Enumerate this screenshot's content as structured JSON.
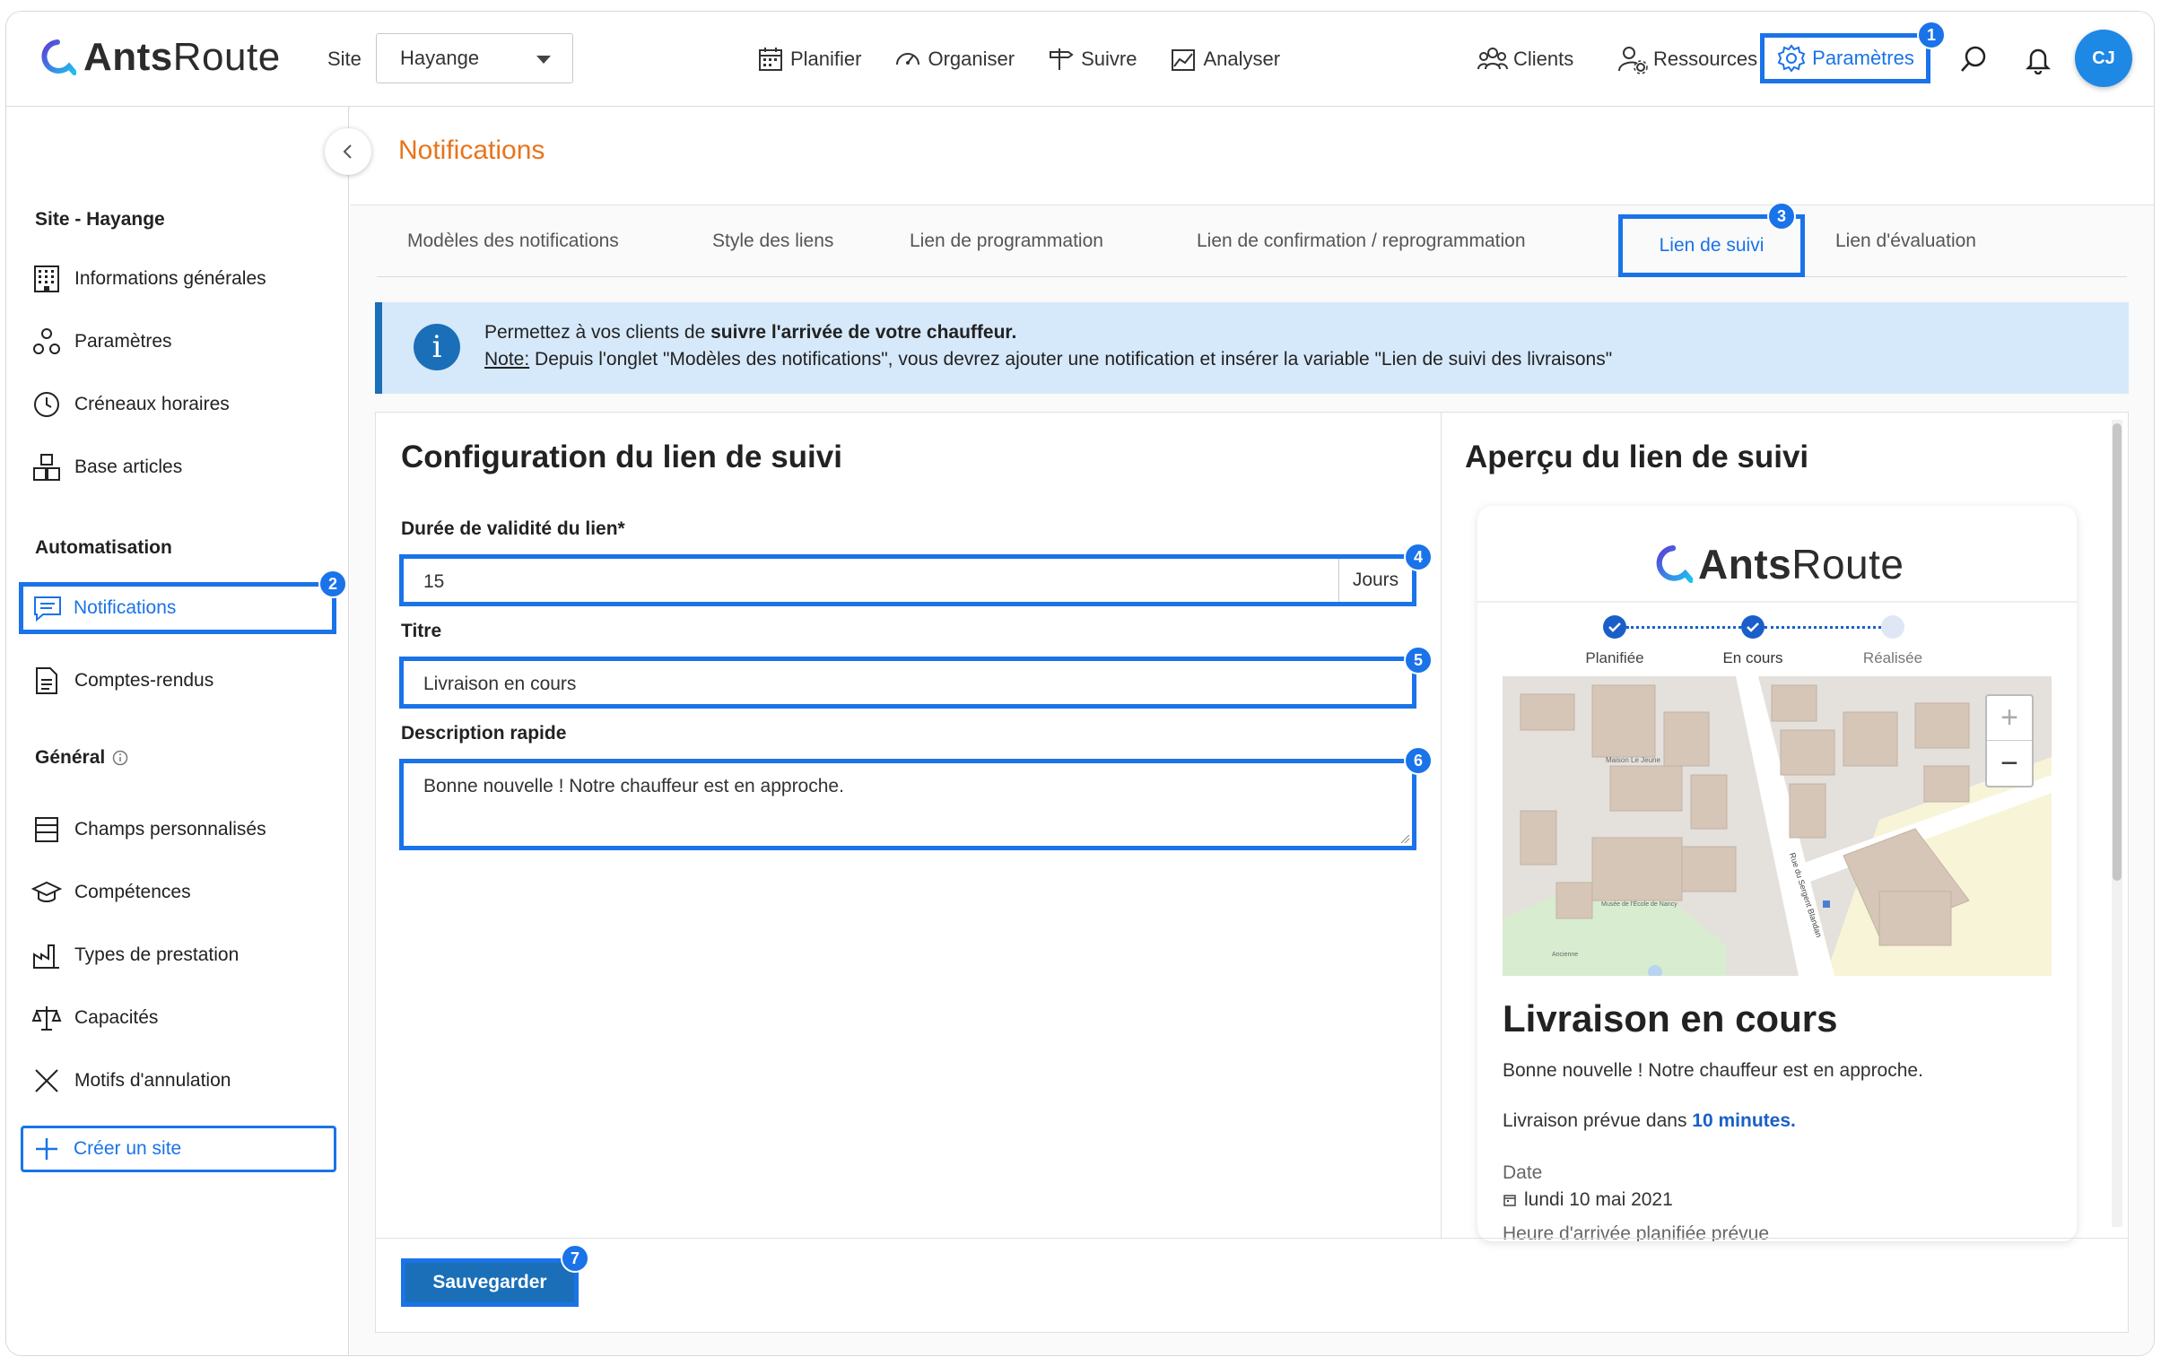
{
  "app": {
    "logo_text_bold": "Ants",
    "logo_text_rest": "Route",
    "site_label": "Site",
    "site_value": "Hayange",
    "user_initials": "CJ",
    "accent_color": "#1a73e8",
    "title_color": "#e8741b"
  },
  "nav": {
    "main": [
      {
        "label": "Planifier",
        "icon": "calendar-icon"
      },
      {
        "label": "Organiser",
        "icon": "speedometer-icon"
      },
      {
        "label": "Suivre",
        "icon": "signpost-icon"
      },
      {
        "label": "Analyser",
        "icon": "chart-icon"
      }
    ],
    "clients": "Clients",
    "ressources": "Ressources",
    "parametres": "Paramètres"
  },
  "badges": [
    "1",
    "2",
    "3",
    "4",
    "5",
    "6",
    "7"
  ],
  "sidebar": {
    "site_title": "Site - Hayange",
    "site_items": [
      {
        "label": "Informations générales",
        "icon": "building-icon"
      },
      {
        "label": "Paramètres",
        "icon": "settings-nodes-icon"
      },
      {
        "label": "Créneaux horaires",
        "icon": "clock-icon"
      },
      {
        "label": "Base articles",
        "icon": "boxes-icon"
      }
    ],
    "auto_title": "Automatisation",
    "auto_items": [
      {
        "label": "Notifications",
        "icon": "chat-icon"
      },
      {
        "label": "Comptes-rendus",
        "icon": "document-icon"
      }
    ],
    "general_title": "Général",
    "general_items": [
      {
        "label": "Champs personnalisés",
        "icon": "list-icon"
      },
      {
        "label": "Compétences",
        "icon": "graduation-cap-icon"
      },
      {
        "label": "Types de prestation",
        "icon": "factory-icon"
      },
      {
        "label": "Capacités",
        "icon": "scale-icon"
      },
      {
        "label": "Motifs d'annulation",
        "icon": "cross-icon"
      }
    ],
    "create_site": "Créer un site"
  },
  "page": {
    "title": "Notifications",
    "tabs": [
      "Modèles des notifications",
      "Style des liens",
      "Lien de programmation",
      "Lien de confirmation / reprogrammation",
      "Lien de suivi",
      "Lien d'évaluation"
    ],
    "info": {
      "line1_prefix": "Permettez à vos clients de ",
      "line1_bold": "suivre l'arrivée de votre chauffeur.",
      "note_label": "Note:",
      "line2": " Depuis l'onglet \"Modèles des notifications\", vous devrez ajouter une notification et insérer la variable \"Lien de suivi des livraisons\""
    }
  },
  "form": {
    "heading": "Configuration du lien de suivi",
    "duree_label": "Durée de validité du lien*",
    "duree_value": "15",
    "duree_suffix": "Jours",
    "titre_label": "Titre",
    "titre_value": "Livraison en cours",
    "desc_label": "Description rapide",
    "desc_value": "Bonne nouvelle ! Notre chauffeur est en approche.",
    "save": "Sauvegarder"
  },
  "preview": {
    "heading": "Aperçu du lien de suivi",
    "steps": [
      "Planifiée",
      "En cours",
      "Réalisée"
    ],
    "title": "Livraison en cours",
    "desc": "Bonne nouvelle ! Notre chauffeur est en approche.",
    "eta_prefix": "Livraison prévue dans ",
    "eta_value": "10 minutes.",
    "date_label": "Date",
    "date_value": "lundi 10 mai 2021",
    "heure_label": "Heure d'arrivée planifiée prévue",
    "map_street": "Rue du Sergent Blandan",
    "map_label_maison": "Maison Le Jeune",
    "map_label_musee": "Musée de l'École de Nancy",
    "map_label_ancienne": "Ancienne"
  }
}
